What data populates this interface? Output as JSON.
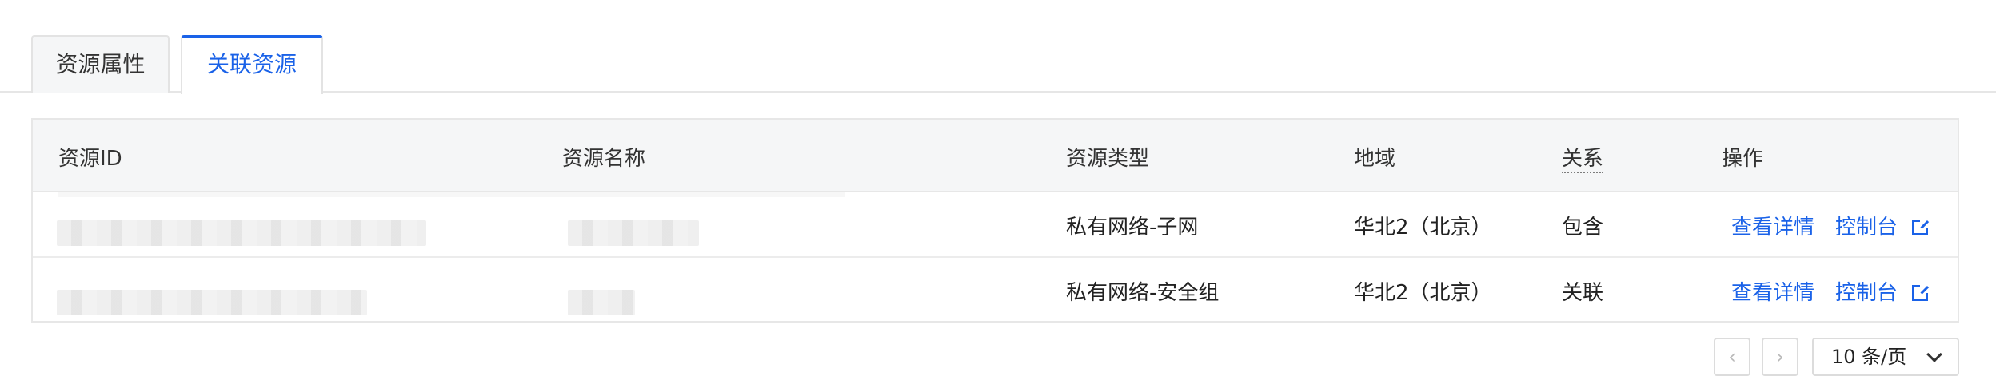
{
  "tabs": {
    "inactive": "资源属性",
    "active": "关联资源"
  },
  "table": {
    "headers": {
      "id": "资源ID",
      "name": "资源名称",
      "type": "资源类型",
      "region": "地域",
      "relation": "关系",
      "actions": "操作"
    },
    "rows": [
      {
        "type": "私有网络-子网",
        "region": "华北2（北京）",
        "relation": "包含",
        "detail": "查看详情",
        "console": "控制台"
      },
      {
        "type": "私有网络-安全组",
        "region": "华北2（北京）",
        "relation": "关联",
        "detail": "查看详情",
        "console": "控制台"
      }
    ]
  },
  "pagination": {
    "prev_icon": "‹",
    "next_icon": "›",
    "page_size": "10 条/页"
  },
  "colors": {
    "accent": "#1a62e8",
    "header_bg": "#f5f6f7",
    "border": "#e7e7e7"
  }
}
